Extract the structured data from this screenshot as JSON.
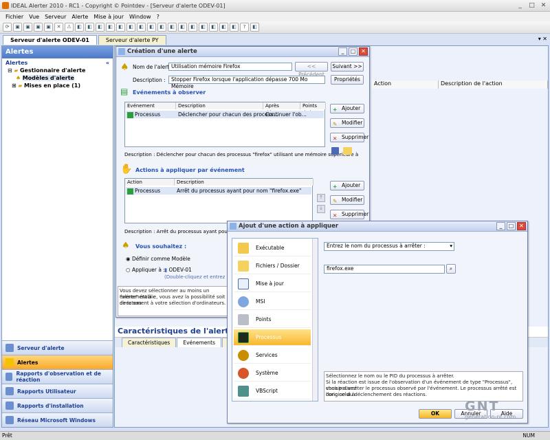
{
  "window": {
    "title": "IDEAL Alerter 2010 - RC1 - Copyright © Pointdev - [Serveur d'alerte ODEV-01]"
  },
  "menu": [
    "Fichier",
    "Vue",
    "Serveur",
    "Alerte",
    "Mise à jour",
    "Window",
    "?"
  ],
  "doc_tabs": [
    "Serveur d'alerte ODEV-01",
    "Serveur d'alerte PY"
  ],
  "left_panel": {
    "header": "Alertes",
    "section": "Alertes",
    "tree": [
      "Gestionnaire d'alerte",
      "Modèles d'alerte",
      "Mises en place (1)"
    ],
    "nav": [
      "Serveur d'alerte",
      "Alertes",
      "Rapports d'observation et de réaction",
      "Rapports Utilisateur",
      "Rapports d'installation",
      "Réseau Microsoft Windows"
    ]
  },
  "background_columns": [
    "Action",
    "Description de l'action"
  ],
  "creation_dialog": {
    "title": "Création d'une alerte",
    "name_label": "Nom de l'alerte :",
    "name_value": "Utilisation mémoire Firefox",
    "prev_button": "<< Précédent",
    "next_button": "Suivant >>",
    "description_label": "Description :",
    "description_value": "Stopper Firefox lorsque l'application dépasse 700 Mo Mémoire",
    "properties_button": "Propriétés",
    "events_group": "Evénements à observer",
    "events_columns": [
      "Evénement",
      "Description",
      "Après détect...",
      "Points d'al"
    ],
    "events_row": [
      "Processus",
      "Déclencher pour chacun des process...",
      "Continuer l'ob..."
    ],
    "events_desc": "Description : Déclencher pour chacun des processus \"firefox\" utilisant une mémoire supérieure à",
    "actions_group": "Actions à appliquer par événement",
    "actions_columns": [
      "Action",
      "Description"
    ],
    "actions_row": [
      "Processus",
      "Arrêt du processus ayant pour nom \"firefox.exe\""
    ],
    "actions_desc": "Description : Arrêt du processus ayant pour nom \"",
    "add_button": "Ajouter",
    "modify_button": "Modifier",
    "delete_button": "Supprimer",
    "wish_group": "Vous souhaitez :",
    "define_model": "Définir comme Modèle",
    "apply_to": "Appliquer à :",
    "apply_target": "ODEV-01",
    "double_click_hint": "(Double-cliquez et entrez les v",
    "info_text": [
      "Vous devez sélectionner au moins un événement à c",
      "\"alerte\" établie, vous avez la possibilité soit de la sau",
      "directement à votre sélection d'ordinateurs."
    ]
  },
  "details": {
    "title": "Caractéristiques de l'alerte",
    "tabs": [
      "Caractéristiques",
      "Evénements",
      "Rapp"
    ]
  },
  "action_dialog": {
    "title": "Ajout d'une action à appliquer",
    "categories": [
      "Exécutable",
      "Fichiers / Dossier",
      "Mise à jour",
      "MSI",
      "Points",
      "Processus",
      "Services",
      "Système",
      "VBScript"
    ],
    "selected": "Processus",
    "mode_select": "Entrez le nom du processus à arrêter :",
    "process_value": "firefox.exe",
    "help_text": [
      "Sélectionnez le nom ou le PID du processus à arrêter.",
      "Si la réaction est issue de l'observation d'un événement de type \"Processus\", vous pouvez",
      "choisir d'arrêter le processus observé par l'événement. Le processus arrêté est donc celui à",
      "l'origine du déclenchement des réactions."
    ],
    "ok": "OK",
    "cancel": "Annuler",
    "help": "Aide"
  },
  "status": {
    "left": "Prêt",
    "right": "NUM"
  },
  "watermark": {
    "logo": "GNT",
    "site": "generation-nt.com"
  }
}
